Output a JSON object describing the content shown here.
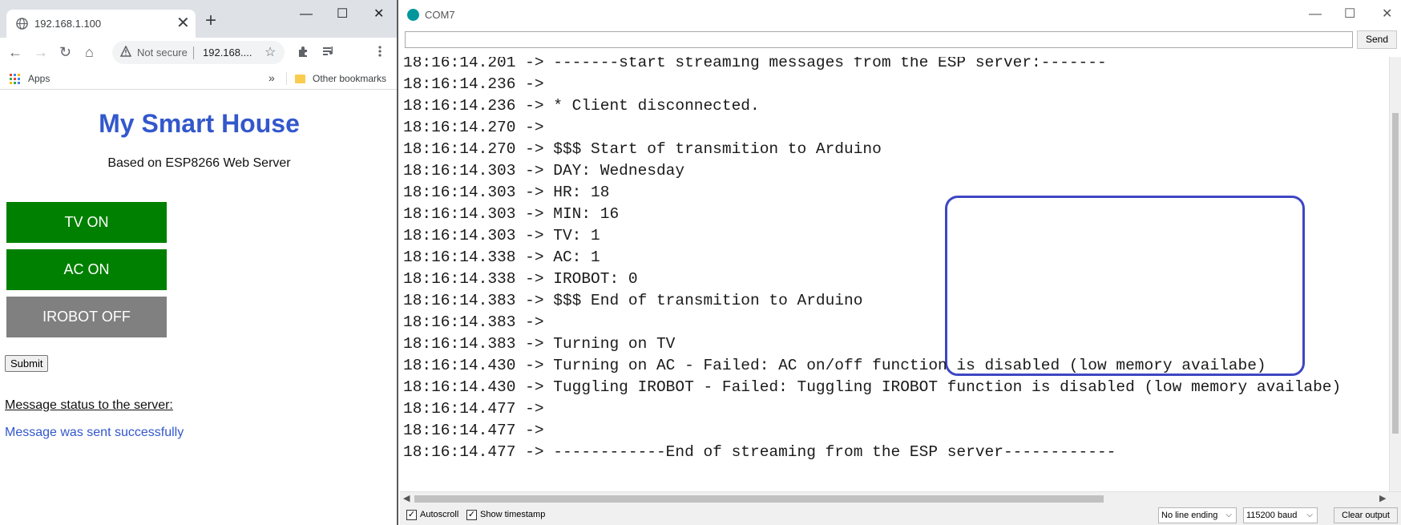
{
  "browser": {
    "tab_title": "192.168.1.100",
    "new_tab_symbol": "+",
    "tab_close_symbol": "✕",
    "window_controls": {
      "minimize": "—",
      "maximize": "☐",
      "close": "✕"
    },
    "nav": {
      "back": "←",
      "forward": "→",
      "reload": "↻",
      "home": "⌂"
    },
    "omnibox": {
      "security_icon": "warning-triangle",
      "security_text": "Not secure",
      "url": "192.168...."
    },
    "bookmarks_bar": {
      "apps_label": "Apps",
      "overflow": "»",
      "other_bookmarks": "Other bookmarks"
    },
    "page": {
      "title": "My Smart House",
      "subtitle": "Based on ESP8266 Web Server",
      "buttons": [
        {
          "label": "TV ON",
          "state": "on",
          "color": "#008000"
        },
        {
          "label": "AC ON",
          "state": "on",
          "color": "#008000"
        },
        {
          "label": "IROBOT OFF",
          "state": "off",
          "color": "#808080"
        }
      ],
      "submit_label": "Submit",
      "status_label": "Message status to the server:",
      "status_message": "Message was sent successfully"
    }
  },
  "serial_monitor": {
    "title": "COM7",
    "window_controls": {
      "minimize": "—",
      "maximize": "☐",
      "close": "✕"
    },
    "input_value": "",
    "send_label": "Send",
    "lines": [
      {
        "time": "18:16:14.201",
        "text": "-------start streaming messages from the ESP server:-------"
      },
      {
        "time": "18:16:14.236",
        "text": ""
      },
      {
        "time": "18:16:14.236",
        "text": "* Client disconnected."
      },
      {
        "time": "18:16:14.270",
        "text": ""
      },
      {
        "time": "18:16:14.270",
        "text": "$$$ Start of transmition to Arduino"
      },
      {
        "time": "18:16:14.303",
        "text": "DAY: Wednesday"
      },
      {
        "time": "18:16:14.303",
        "text": "HR: 18"
      },
      {
        "time": "18:16:14.303",
        "text": "MIN: 16"
      },
      {
        "time": "18:16:14.303",
        "text": "TV: 1"
      },
      {
        "time": "18:16:14.338",
        "text": "AC: 1"
      },
      {
        "time": "18:16:14.338",
        "text": "IROBOT: 0"
      },
      {
        "time": "18:16:14.383",
        "text": "$$$ End of transmition to Arduino"
      },
      {
        "time": "18:16:14.383",
        "text": ""
      },
      {
        "time": "18:16:14.383",
        "text": "Turning on TV"
      },
      {
        "time": "18:16:14.430",
        "text": "Turning on AC - Failed: AC on/off function is disabled (low memory availabe)"
      },
      {
        "time": "18:16:14.430",
        "text": "Tuggling IROBOT - Failed: Tuggling IROBOT function is disabled (low memory availabe)"
      },
      {
        "time": "18:16:14.477",
        "text": ""
      },
      {
        "time": "18:16:14.477",
        "text": ""
      },
      {
        "time": "18:16:14.477",
        "text": "------------End of streaming from the ESP server------------"
      }
    ],
    "arrow": "->",
    "highlight_color": "#3e46c3",
    "status_bar": {
      "autoscroll_label": "Autoscroll",
      "autoscroll_checked": true,
      "show_timestamp_label": "Show timestamp",
      "show_timestamp_checked": true,
      "line_ending": "No line ending",
      "baud_rate": "115200 baud",
      "clear_label": "Clear output"
    }
  }
}
